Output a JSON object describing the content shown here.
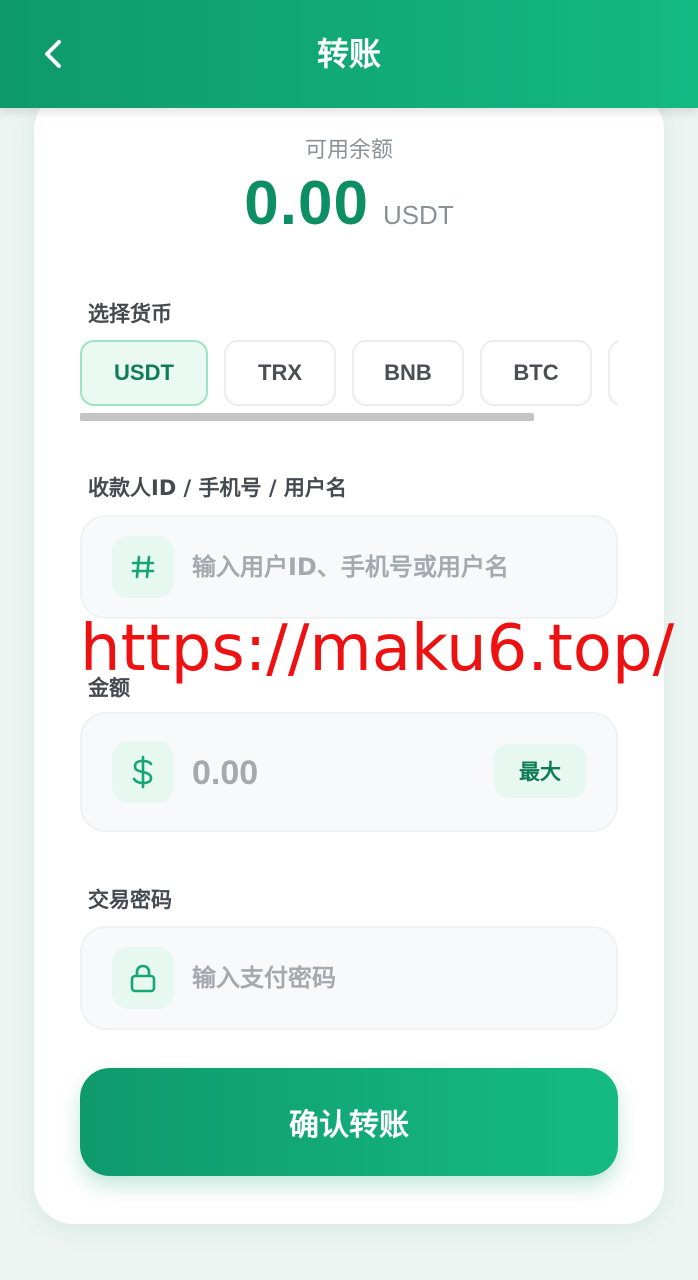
{
  "header": {
    "title": "转账",
    "back_icon": "chevron-left-icon"
  },
  "balance": {
    "label": "可用余额",
    "value": "0.00",
    "unit": "USDT"
  },
  "currency": {
    "label": "选择货币",
    "options": [
      "USDT",
      "TRX",
      "BNB",
      "BTC"
    ],
    "selected": "USDT"
  },
  "recipient": {
    "label": "收款人ID / 手机号 / 用户名",
    "icon": "hash-icon",
    "placeholder": "输入用户ID、手机号或用户名"
  },
  "amount": {
    "label": "金额",
    "icon": "dollar-icon",
    "placeholder": "0.00",
    "max_label": "最大"
  },
  "password": {
    "label": "交易密码",
    "icon": "lock-icon",
    "placeholder": "输入支付密码"
  },
  "confirm_label": "确认转账",
  "watermark": "https://maku6.top/",
  "colors": {
    "primary": "#10a673",
    "primary_light": "#e6f8f0",
    "watermark": "#ee1111"
  }
}
